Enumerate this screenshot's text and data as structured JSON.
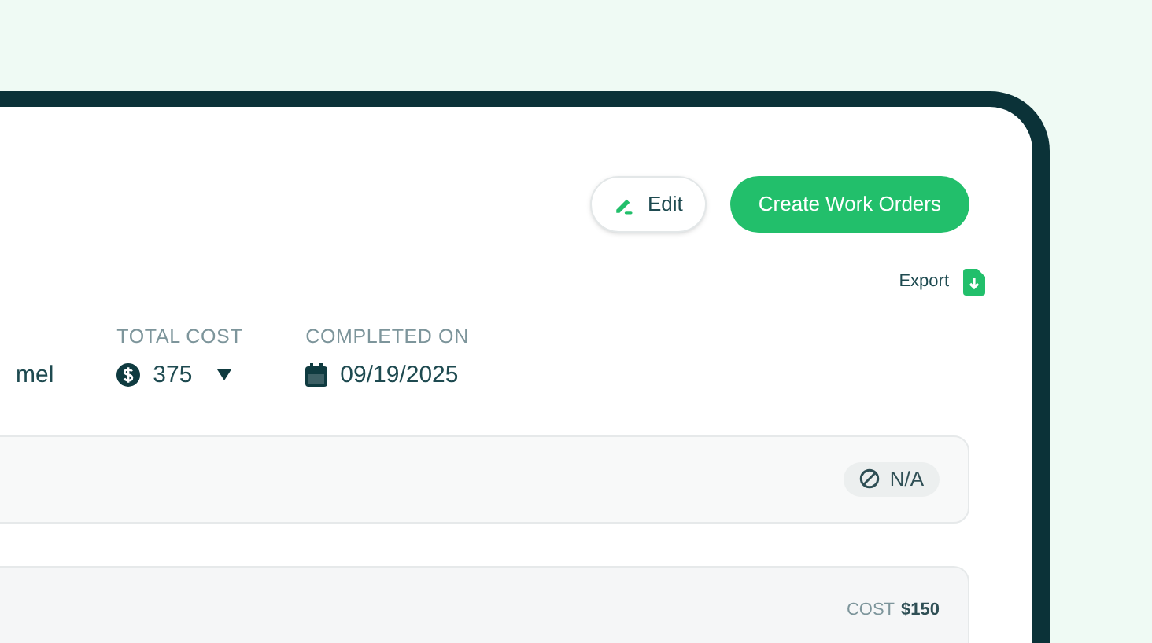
{
  "header_actions": [
    {
      "label": "Edit",
      "kind": "outline"
    },
    {
      "label": "Create Work Orders",
      "kind": "primary"
    }
  ],
  "export": {
    "label": "Export"
  },
  "stats": [
    {
      "kind": "text",
      "value": "mel"
    },
    {
      "kind": "cost",
      "label": "TOTAL COST",
      "value": "375"
    },
    {
      "kind": "date",
      "label": "COMPLETED ON",
      "value": "09/19/2025"
    }
  ],
  "cards": [
    {
      "kind": "status",
      "badge": "N/A"
    },
    {
      "kind": "cost",
      "label": "COST",
      "amount": "$150"
    }
  ]
}
